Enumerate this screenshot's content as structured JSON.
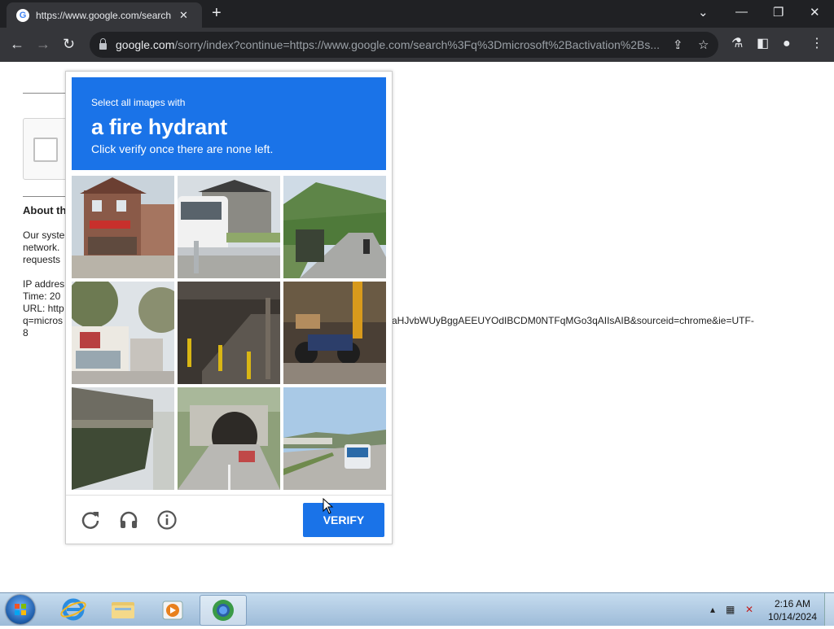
{
  "browser": {
    "tab_title": "https://www.google.com/search",
    "tab_favicon": "G",
    "url_host": "google.com",
    "url_rest": "/sorry/index?continue=https://www.google.com/search%3Fq%3Dmicrosoft%2Bactivation%2Bs..."
  },
  "page": {
    "about_heading": "About th",
    "para_lines": [
      "Our syste",
      "network.",
      "requests"
    ],
    "ip_label": "IP addres",
    "time_label": "Time: 20",
    "url_label": "URL: http",
    "url_line2_left": "q=micros",
    "url_line2_right": "aHJvbWUyBggAEEUYOdIBCDM0NTFqMGo3qAIIsAIB&sourceid=chrome&ie=UTF-",
    "url_line3": "8"
  },
  "captcha": {
    "instruction_small": "Select all images with",
    "target_object": "a fire hydrant",
    "instruction_sub": "Click verify once there are none left.",
    "verify_label": "VERIFY",
    "tiles": [
      "house-with-red-awning",
      "white-van-and-guardrail",
      "truck-on-rural-road",
      "street-with-trees",
      "parking-garage-stairs",
      "motorcycle-in-shop",
      "highway-overpass",
      "road-tunnel",
      "road-with-bus"
    ]
  },
  "taskbar": {
    "time": "2:16 AM",
    "date": "10/14/2024"
  },
  "colors": {
    "captcha_blue": "#1a73e8",
    "chrome_dark": "#202124",
    "chrome_toolbar": "#35363a"
  }
}
